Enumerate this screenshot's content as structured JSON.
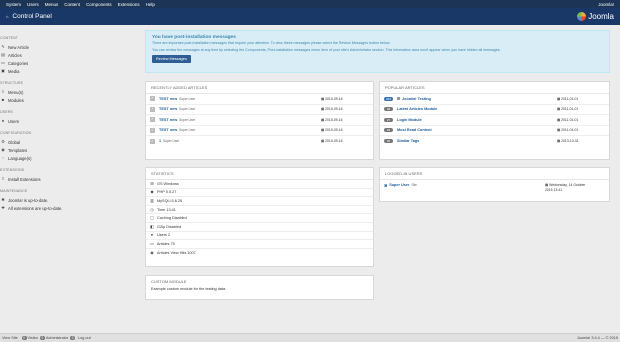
{
  "topnav": {
    "menu": [
      "System",
      "Users",
      "Menus",
      "Content",
      "Components",
      "Extensions",
      "Help"
    ],
    "site": "Joomla!"
  },
  "header": {
    "title": "Control Panel",
    "logo_text": "Joomla"
  },
  "sidebar": {
    "sections": [
      {
        "heading": "CONTENT",
        "items": [
          "New Article",
          "Articles",
          "Categories",
          "Media"
        ]
      },
      {
        "heading": "STRUCTURE",
        "items": [
          "Menu(s)",
          "Modules"
        ]
      },
      {
        "heading": "USERS",
        "items": [
          "Users"
        ]
      },
      {
        "heading": "CONFIGURATION",
        "items": [
          "Global",
          "Templates",
          "Language(s)"
        ]
      },
      {
        "heading": "EXTENSIONS",
        "items": [
          "Install Extensions"
        ]
      },
      {
        "heading": "MAINTENANCE",
        "items": [
          "Joomla! is up-to-date.",
          "All extensions are up-to-date."
        ]
      }
    ]
  },
  "alert": {
    "title": "You have post-installation messages",
    "line1": "There are important post-installation messages that require your attention. To view these messages please select the Review Messages button below.",
    "line2": "You can review the messages at any time by selecting the Components, Post-installation messages menu item of your site's Administrator section. This information area won't appear when you have hidden all messages.",
    "button": "Review Messages"
  },
  "recent": {
    "heading": "RECENTLY ADDED ARTICLES",
    "rows": [
      {
        "title": "TEST new",
        "by": "Super User",
        "date": "2015-09-16"
      },
      {
        "title": "TEST new",
        "by": "Super User",
        "date": "2015-09-16"
      },
      {
        "title": "TEST new",
        "by": "Super User",
        "date": "2015-09-16"
      },
      {
        "title": "TEST new",
        "by": "Super User",
        "date": "2015-09-16"
      },
      {
        "title": "1",
        "by": "Super User",
        "date": "2015-09-16"
      }
    ]
  },
  "popular": {
    "heading": "POPULAR ARTICLES",
    "rows": [
      {
        "hits": "333",
        "color": "#3a6fa9",
        "title": "Joomla! Testing",
        "date": "2011-01-01"
      },
      {
        "hits": "28",
        "color": "#777777",
        "title": "Latest Articles Module",
        "date": "2011-01-01"
      },
      {
        "hits": "27",
        "color": "#777777",
        "title": "Login Module",
        "date": "2011-01-01"
      },
      {
        "hits": "26",
        "color": "#777777",
        "title": "Most Read Content",
        "date": "2011-01-01"
      },
      {
        "hits": "26",
        "color": "#777777",
        "title": "Similar Tags",
        "date": "2013-10-31"
      }
    ]
  },
  "logged": {
    "heading": "LOGGED-IN USERS",
    "user": "Super User",
    "role": "Site",
    "date_line1": "Wednesday, 14 October",
    "date_line2": "2015 13:41"
  },
  "stats": {
    "heading": "STATISTICS",
    "rows": [
      {
        "icon": "windows-icon",
        "text": "OS Windows"
      },
      {
        "icon": "php-icon",
        "text": "PHP 5.5.27"
      },
      {
        "icon": "database-icon",
        "text": "MySQLi 5.6.25"
      },
      {
        "icon": "clock-icon",
        "text": "Time 13:41"
      },
      {
        "icon": "cache-icon",
        "text": "Caching Disabled"
      },
      {
        "icon": "gzip-icon",
        "text": "GZip Disabled"
      },
      {
        "icon": "users-icon",
        "text": "Users 2"
      },
      {
        "icon": "article-icon",
        "text": "Articles 75"
      },
      {
        "icon": "eye-icon",
        "text": "Articles View Hits 1007"
      }
    ]
  },
  "custom": {
    "heading": "CUSTOM MODULE",
    "text": "Example custom module for the testing data."
  },
  "footer": {
    "view_site": "View Site",
    "visitors_count": "0",
    "visitors": "Visitor",
    "admins_count": "0",
    "admins": "Administrator",
    "messages_count": "0",
    "logout": "Log out",
    "version": "Joomla! 3.4.4 — © 2015"
  },
  "colors": {
    "nav": "#1c3557",
    "header": "#1a3867",
    "link": "#1a5b9c",
    "alert_bg": "#d9edf7"
  }
}
